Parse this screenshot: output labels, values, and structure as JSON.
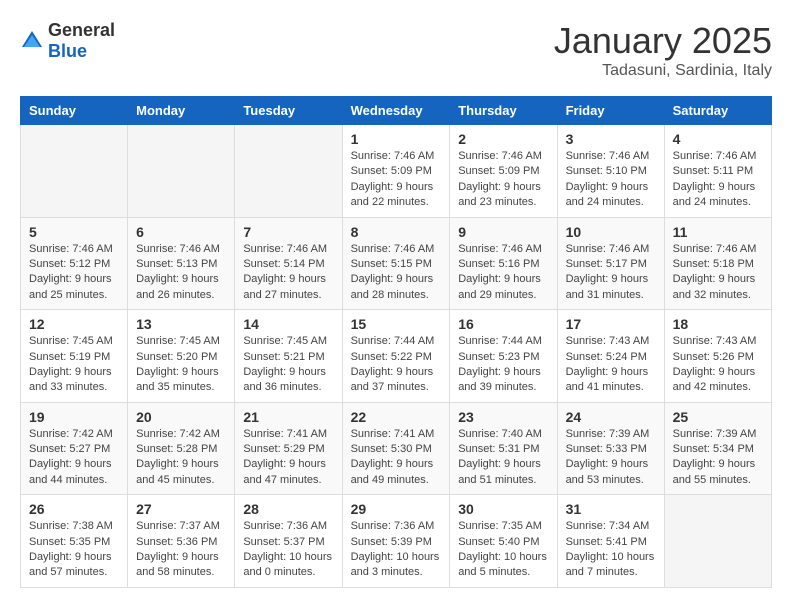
{
  "header": {
    "logo_general": "General",
    "logo_blue": "Blue",
    "month": "January 2025",
    "location": "Tadasuni, Sardinia, Italy"
  },
  "weekdays": [
    "Sunday",
    "Monday",
    "Tuesday",
    "Wednesday",
    "Thursday",
    "Friday",
    "Saturday"
  ],
  "rows": [
    {
      "cells": [
        {
          "day": "",
          "info": ""
        },
        {
          "day": "",
          "info": ""
        },
        {
          "day": "",
          "info": ""
        },
        {
          "day": "1",
          "info": "Sunrise: 7:46 AM\nSunset: 5:09 PM\nDaylight: 9 hours and 22 minutes."
        },
        {
          "day": "2",
          "info": "Sunrise: 7:46 AM\nSunset: 5:09 PM\nDaylight: 9 hours and 23 minutes."
        },
        {
          "day": "3",
          "info": "Sunrise: 7:46 AM\nSunset: 5:10 PM\nDaylight: 9 hours and 24 minutes."
        },
        {
          "day": "4",
          "info": "Sunrise: 7:46 AM\nSunset: 5:11 PM\nDaylight: 9 hours and 24 minutes."
        }
      ]
    },
    {
      "cells": [
        {
          "day": "5",
          "info": "Sunrise: 7:46 AM\nSunset: 5:12 PM\nDaylight: 9 hours and 25 minutes."
        },
        {
          "day": "6",
          "info": "Sunrise: 7:46 AM\nSunset: 5:13 PM\nDaylight: 9 hours and 26 minutes."
        },
        {
          "day": "7",
          "info": "Sunrise: 7:46 AM\nSunset: 5:14 PM\nDaylight: 9 hours and 27 minutes."
        },
        {
          "day": "8",
          "info": "Sunrise: 7:46 AM\nSunset: 5:15 PM\nDaylight: 9 hours and 28 minutes."
        },
        {
          "day": "9",
          "info": "Sunrise: 7:46 AM\nSunset: 5:16 PM\nDaylight: 9 hours and 29 minutes."
        },
        {
          "day": "10",
          "info": "Sunrise: 7:46 AM\nSunset: 5:17 PM\nDaylight: 9 hours and 31 minutes."
        },
        {
          "day": "11",
          "info": "Sunrise: 7:46 AM\nSunset: 5:18 PM\nDaylight: 9 hours and 32 minutes."
        }
      ]
    },
    {
      "cells": [
        {
          "day": "12",
          "info": "Sunrise: 7:45 AM\nSunset: 5:19 PM\nDaylight: 9 hours and 33 minutes."
        },
        {
          "day": "13",
          "info": "Sunrise: 7:45 AM\nSunset: 5:20 PM\nDaylight: 9 hours and 35 minutes."
        },
        {
          "day": "14",
          "info": "Sunrise: 7:45 AM\nSunset: 5:21 PM\nDaylight: 9 hours and 36 minutes."
        },
        {
          "day": "15",
          "info": "Sunrise: 7:44 AM\nSunset: 5:22 PM\nDaylight: 9 hours and 37 minutes."
        },
        {
          "day": "16",
          "info": "Sunrise: 7:44 AM\nSunset: 5:23 PM\nDaylight: 9 hours and 39 minutes."
        },
        {
          "day": "17",
          "info": "Sunrise: 7:43 AM\nSunset: 5:24 PM\nDaylight: 9 hours and 41 minutes."
        },
        {
          "day": "18",
          "info": "Sunrise: 7:43 AM\nSunset: 5:26 PM\nDaylight: 9 hours and 42 minutes."
        }
      ]
    },
    {
      "cells": [
        {
          "day": "19",
          "info": "Sunrise: 7:42 AM\nSunset: 5:27 PM\nDaylight: 9 hours and 44 minutes."
        },
        {
          "day": "20",
          "info": "Sunrise: 7:42 AM\nSunset: 5:28 PM\nDaylight: 9 hours and 45 minutes."
        },
        {
          "day": "21",
          "info": "Sunrise: 7:41 AM\nSunset: 5:29 PM\nDaylight: 9 hours and 47 minutes."
        },
        {
          "day": "22",
          "info": "Sunrise: 7:41 AM\nSunset: 5:30 PM\nDaylight: 9 hours and 49 minutes."
        },
        {
          "day": "23",
          "info": "Sunrise: 7:40 AM\nSunset: 5:31 PM\nDaylight: 9 hours and 51 minutes."
        },
        {
          "day": "24",
          "info": "Sunrise: 7:39 AM\nSunset: 5:33 PM\nDaylight: 9 hours and 53 minutes."
        },
        {
          "day": "25",
          "info": "Sunrise: 7:39 AM\nSunset: 5:34 PM\nDaylight: 9 hours and 55 minutes."
        }
      ]
    },
    {
      "cells": [
        {
          "day": "26",
          "info": "Sunrise: 7:38 AM\nSunset: 5:35 PM\nDaylight: 9 hours and 57 minutes."
        },
        {
          "day": "27",
          "info": "Sunrise: 7:37 AM\nSunset: 5:36 PM\nDaylight: 9 hours and 58 minutes."
        },
        {
          "day": "28",
          "info": "Sunrise: 7:36 AM\nSunset: 5:37 PM\nDaylight: 10 hours and 0 minutes."
        },
        {
          "day": "29",
          "info": "Sunrise: 7:36 AM\nSunset: 5:39 PM\nDaylight: 10 hours and 3 minutes."
        },
        {
          "day": "30",
          "info": "Sunrise: 7:35 AM\nSunset: 5:40 PM\nDaylight: 10 hours and 5 minutes."
        },
        {
          "day": "31",
          "info": "Sunrise: 7:34 AM\nSunset: 5:41 PM\nDaylight: 10 hours and 7 minutes."
        },
        {
          "day": "",
          "info": ""
        }
      ]
    }
  ]
}
